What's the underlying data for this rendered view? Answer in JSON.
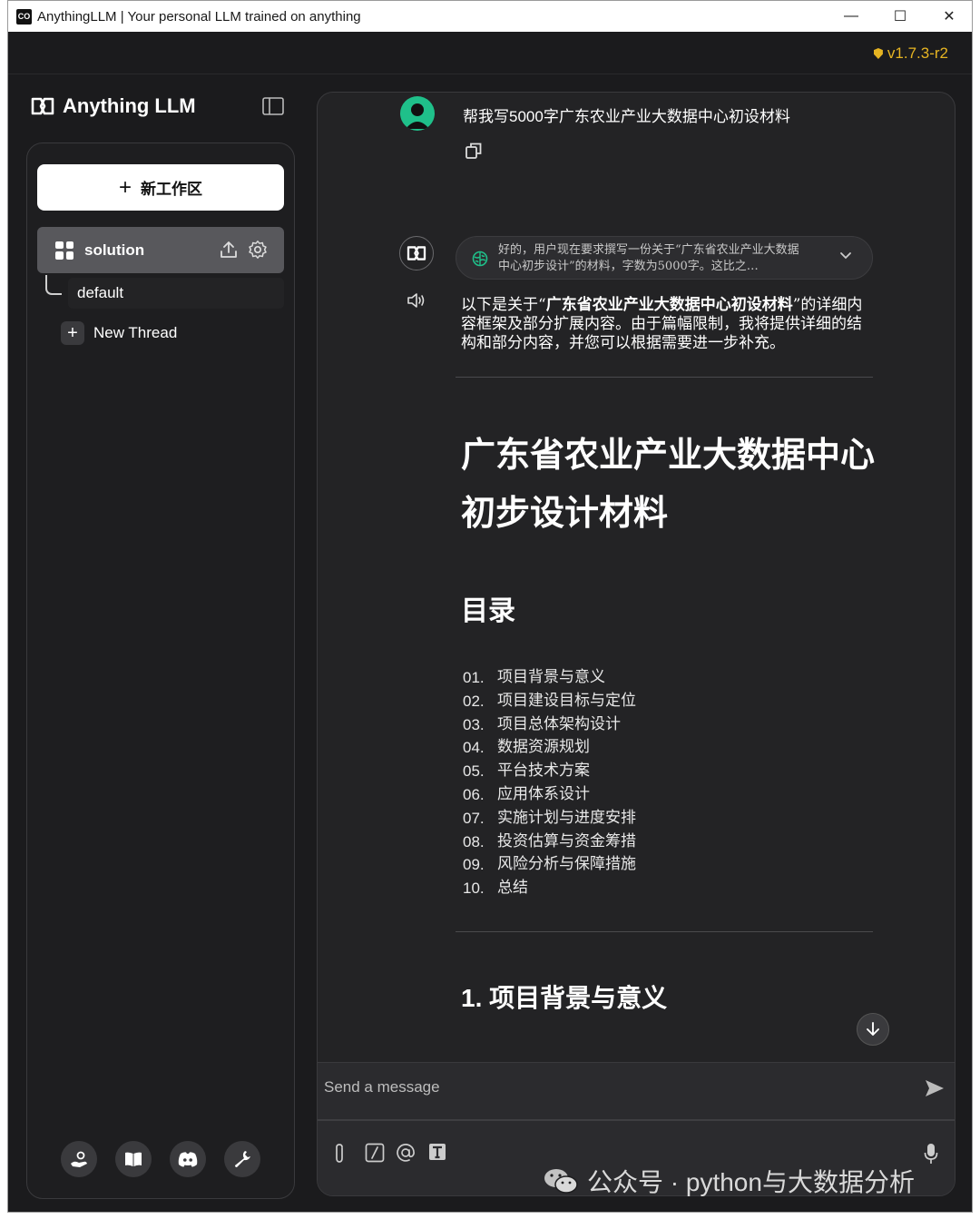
{
  "window": {
    "title": "AnythingLLM | Your personal LLM trained on anything",
    "app_icon_text": "CO",
    "controls": {
      "minimize": "—",
      "maximize": "☐",
      "close": "✕"
    }
  },
  "topbar": {
    "version": "v1.7.3-r2"
  },
  "sidebar": {
    "logo_text": "Anything LLM",
    "new_workspace_label": "新工作区",
    "workspace": {
      "name": "solution"
    },
    "threads": [
      {
        "label": "default"
      }
    ],
    "new_thread_label": "New Thread",
    "footer_icons": [
      "community-hub-icon",
      "docs-book-icon",
      "discord-icon",
      "settings-wrench-icon"
    ]
  },
  "chat": {
    "user_message": "帮我写5000字广东农业产业大数据中心初设材料",
    "thinking": {
      "line1": "好的，用户现在要求撰写一份关于“广东省农业产业大数据",
      "line2": "中心初步设计”的材料，字数为5000字。这比之…"
    },
    "reply_intro": {
      "pre": "以下是关于“",
      "bold": "广东省农业产业大数据中心初设材料",
      "post": "”的详细内容框架及部分扩展内容。由于篇幅限制，我将提供详细的结构和部分内容，并您可以根据需要进一步补充。"
    },
    "doc_title_line1": "广东省农业产业大数据中心",
    "doc_title_line2": "初步设计材料",
    "toc_heading": "目录",
    "toc": [
      {
        "num": "01.",
        "text": "项目背景与意义"
      },
      {
        "num": "02.",
        "text": "项目建设目标与定位"
      },
      {
        "num": "03.",
        "text": "项目总体架构设计"
      },
      {
        "num": "04.",
        "text": "数据资源规划"
      },
      {
        "num": "05.",
        "text": "平台技术方案"
      },
      {
        "num": "06.",
        "text": "应用体系设计"
      },
      {
        "num": "07.",
        "text": "实施计划与进度安排"
      },
      {
        "num": "08.",
        "text": "投资估算与资金筹措"
      },
      {
        "num": "09.",
        "text": "风险分析与保障措施"
      },
      {
        "num": "10.",
        "text": "总结"
      }
    ],
    "section1_heading": "1. 项目背景与意义"
  },
  "composer": {
    "placeholder": "Send a message"
  },
  "watermark": {
    "text": "公众号 · python与大数据分析"
  },
  "colors": {
    "accent_version": "#e6b422",
    "user_avatar": "#1fc08a"
  }
}
